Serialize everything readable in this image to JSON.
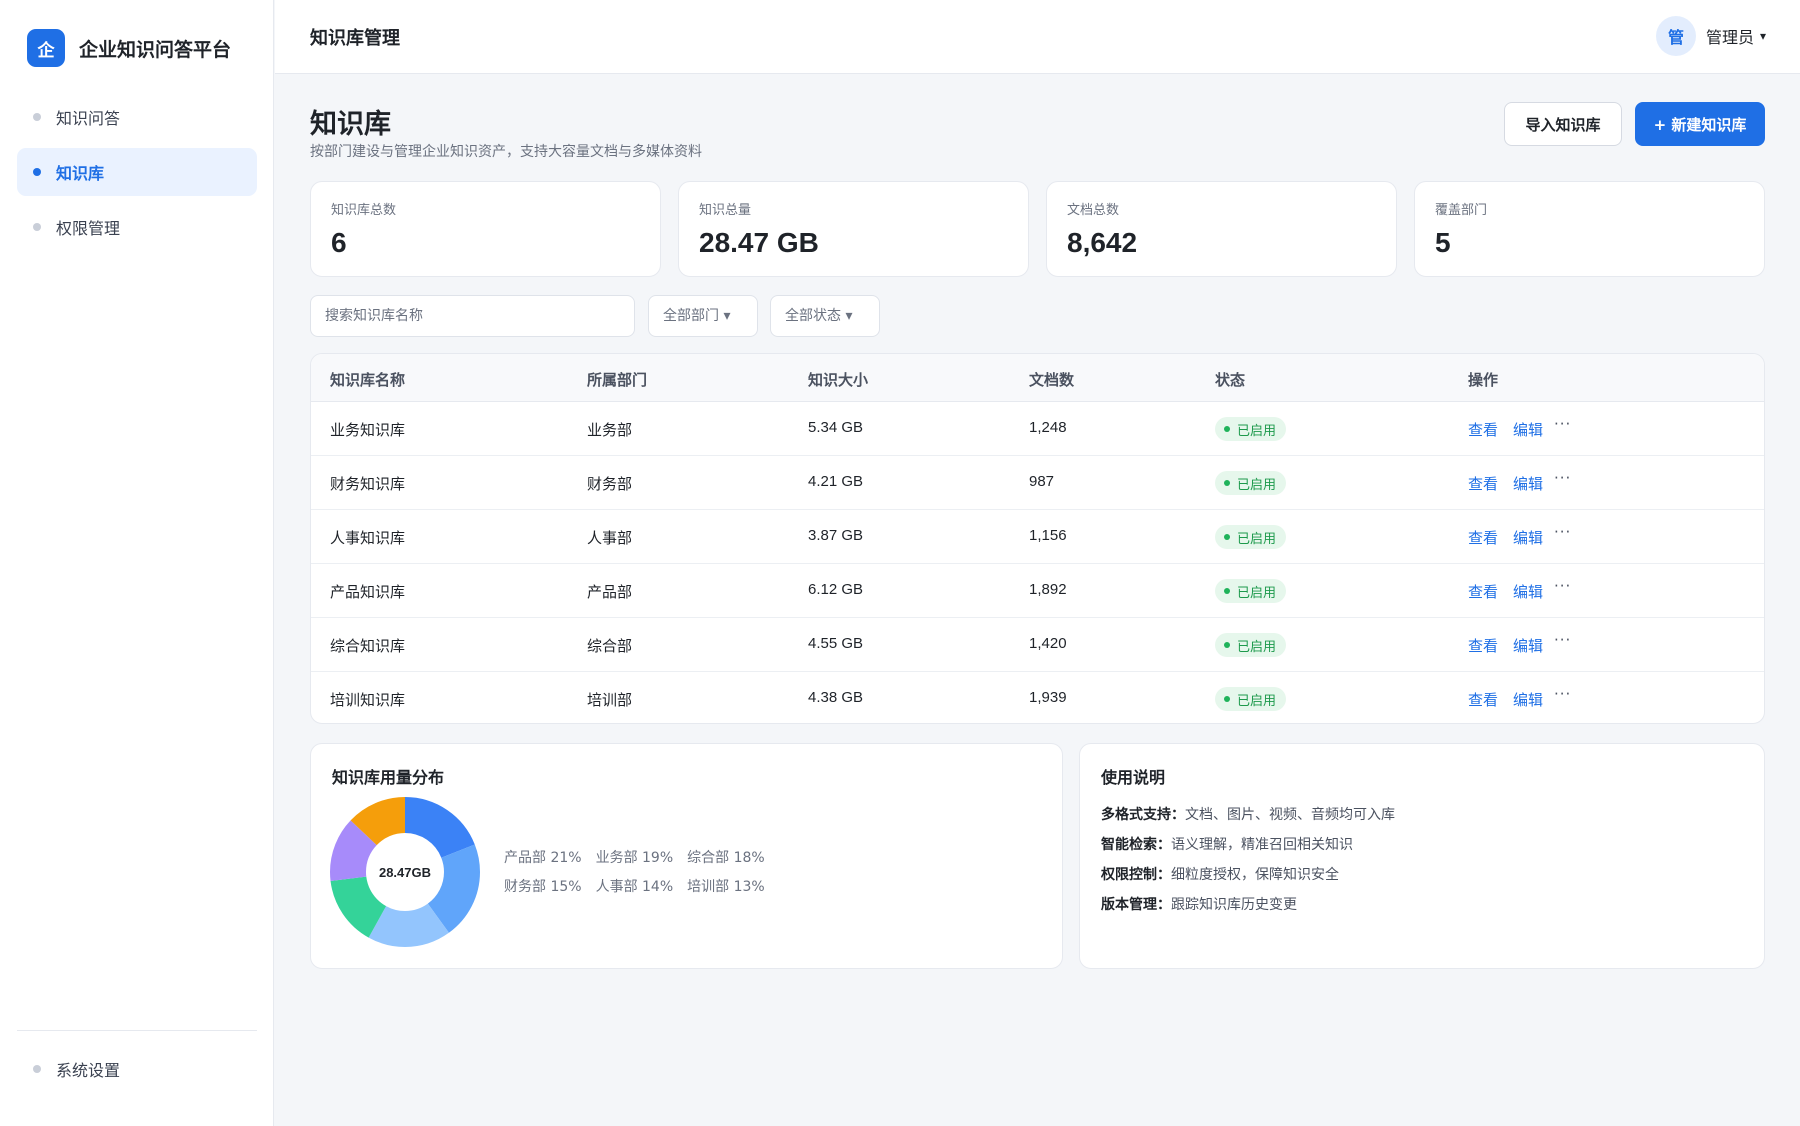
{
  "app": {
    "logo_char": "企",
    "name": "企业知识问答平台"
  },
  "sidebar": {
    "items": [
      {
        "label": "知识问答"
      },
      {
        "label": "知识库"
      },
      {
        "label": "权限管理"
      }
    ],
    "bottom": {
      "label": "系统设置"
    }
  },
  "header": {
    "title": "知识库管理",
    "avatar_char": "管",
    "user_name": "管理员",
    "caret": "▾"
  },
  "page": {
    "title": "知识库",
    "subtitle": "按部门建设与管理企业知识资产，支持大容量文档与多媒体资料",
    "import_label": "导入知识库",
    "new_label": "+ 新建知识库"
  },
  "stats": [
    {
      "label": "知识库总数",
      "value": "6"
    },
    {
      "label": "知识总量",
      "value": "28.47 GB"
    },
    {
      "label": "文档总数",
      "value": "8,642"
    },
    {
      "label": "覆盖部门",
      "value": "5"
    }
  ],
  "filters": {
    "search_placeholder": "搜索知识库名称",
    "dept": "全部部门 ▾",
    "status": "全部状态 ▾"
  },
  "table": {
    "headers": [
      "知识库名称",
      "所属部门",
      "知识大小",
      "文档数",
      "状态",
      "操作"
    ],
    "view_label": "查看",
    "edit_label": "编辑",
    "more_label": "···",
    "rows": [
      {
        "name": "业务知识库",
        "dept": "业务部",
        "size": "5.34 GB",
        "docs": "1,248",
        "status": "已启用"
      },
      {
        "name": "财务知识库",
        "dept": "财务部",
        "size": "4.21 GB",
        "docs": "987",
        "status": "已启用"
      },
      {
        "name": "人事知识库",
        "dept": "人事部",
        "size": "3.87 GB",
        "docs": "1,156",
        "status": "已启用"
      },
      {
        "name": "产品知识库",
        "dept": "产品部",
        "size": "6.12 GB",
        "docs": "1,892",
        "status": "已启用"
      },
      {
        "name": "综合知识库",
        "dept": "综合部",
        "size": "4.55 GB",
        "docs": "1,420",
        "status": "已启用"
      },
      {
        "name": "培训知识库",
        "dept": "培训部",
        "size": "4.38 GB",
        "docs": "1,939",
        "status": "已启用"
      }
    ]
  },
  "usage": {
    "title": "知识库用量分布",
    "center": "28.47GB",
    "legend": [
      "产品部 21%",
      "业务部 19%",
      "综合部 18%",
      "财务部 15%",
      "人事部 14%",
      "培训部 13%"
    ],
    "segments": [
      {
        "dept": "业务部",
        "pct": 19,
        "color": "#3b82f6"
      },
      {
        "dept": "产品部",
        "pct": 21,
        "color": "#60a5fa"
      },
      {
        "dept": "综合部",
        "pct": 18,
        "color": "#93c5fd"
      },
      {
        "dept": "财务部",
        "pct": 15,
        "color": "#34d399"
      },
      {
        "dept": "人事部",
        "pct": 14,
        "color": "#a78bfa"
      },
      {
        "dept": "培训部",
        "pct": 13,
        "color": "#f59e0b"
      }
    ]
  },
  "help": {
    "title": "使用说明",
    "items": [
      {
        "key": "多格式支持：",
        "text": "文档、图片、视频、音频均可入库"
      },
      {
        "key": "智能检索：",
        "text": "语义理解，精准召回相关知识"
      },
      {
        "key": "权限控制：",
        "text": "细粒度授权，保障知识安全"
      },
      {
        "key": "版本管理：",
        "text": "跟踪知识库历史变更"
      }
    ]
  }
}
